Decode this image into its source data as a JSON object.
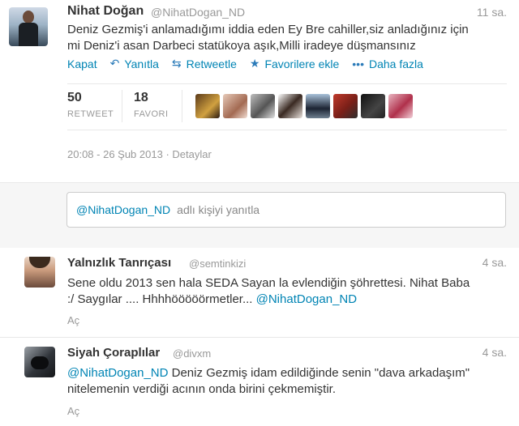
{
  "tweet": {
    "author_name": "Nihat Doğan",
    "author_handle": "@NihatDogan_ND",
    "time": "11 sa.",
    "text_line1": "Deniz Gezmiş'i anlamadığımı iddia eden Ey Bre cahiller,siz anladığınız için",
    "text_line2": "mi Deniz'i asan Darbeci statükoya aşık,Milli iradeye düşmansınız",
    "actions": {
      "close": "Kapat",
      "reply": "Yanıtla",
      "retweet": "Retweetle",
      "favorite": "Favorilere ekle",
      "more": "Daha fazla"
    },
    "stats": {
      "retweet_count": "50",
      "retweet_label": "RETWEET",
      "favorite_count": "18",
      "favorite_label": "FAVORI"
    },
    "datetime": "20:08 - 26 Şub 2013",
    "details_sep": " · ",
    "details": "Detaylar"
  },
  "reply_box": {
    "mention": "@NihatDogan_ND",
    "placeholder": "adlı kişiyi yanıtla"
  },
  "replies": [
    {
      "name": "Yalnızlık Tanrıçası",
      "handle": "@semtinkizi",
      "time": "4 sa.",
      "text_line1": "Sene oldu 2013 sen hala SEDA Sayan la evlendiğin şöhrettesi. Nihat Baba",
      "text_line2_pre": ":/ Saygılar .... Hhhhööööörmetler... ",
      "text_line2_mention": "@NihatDogan_ND",
      "open": "Aç"
    },
    {
      "name": "Siyah Çoraplılar",
      "handle": "@divxm",
      "time": "4 sa.",
      "text_mention": "@NihatDogan_ND",
      "text_line1_rest": " Deniz Gezmiş idam edildiğinde senin \"dava arkadaşım\"",
      "text_line2": "nitelemenin verdiği acının onda birini çekmemiştir.",
      "open": "Aç"
    }
  ]
}
